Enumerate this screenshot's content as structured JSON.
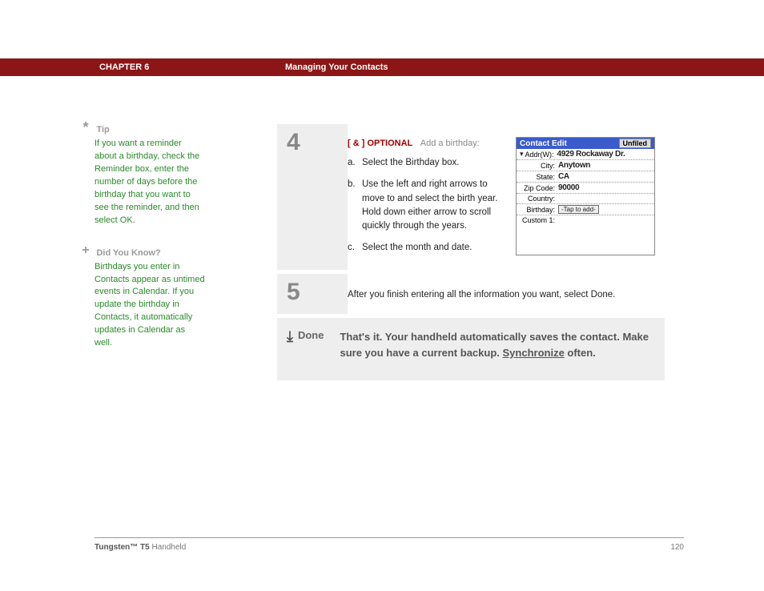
{
  "header": {
    "chapter": "CHAPTER 6",
    "title": "Managing Your Contacts"
  },
  "sidebar": {
    "tip": {
      "heading": "Tip",
      "body": "If you want a reminder about a birthday, check the Reminder box, enter the number of days before the birthday that you want to see the reminder, and then select OK."
    },
    "dyk": {
      "heading": "Did You Know?",
      "body": "Birthdays you enter in Contacts appear as untimed events in Calendar. If you update the birthday in Contacts, it automatically updates in Calendar as well."
    }
  },
  "steps": {
    "s4": {
      "num": "4",
      "tag": "[ & ]  OPTIONAL",
      "lead": "Add a birthday:",
      "a": "Select the Birthday box.",
      "b": "Use the left and right arrows to move to and select the birth year. Hold down either arrow to scroll quickly through the years.",
      "c": "Select the month and date."
    },
    "s5": {
      "num": "5",
      "text": "After you finish entering all the information you want, select Done."
    }
  },
  "device": {
    "title": "Contact Edit",
    "category": "Unfiled",
    "rows": {
      "addr_label": "Addr(W):",
      "addr_value": "4929 Rockaway Dr.",
      "city_label": "City:",
      "city_value": "Anytown",
      "state_label": "State:",
      "state_value": "CA",
      "zip_label": "Zip Code:",
      "zip_value": "90000",
      "country_label": "Country:",
      "country_value": "",
      "birthday_label": "Birthday:",
      "birthday_value": "-Tap to add-",
      "custom_label": "Custom 1:",
      "custom_value": ""
    }
  },
  "done": {
    "label": "Done",
    "text_before": "That's it. Your handheld automatically saves the contact. Make sure you have a current backup. ",
    "link": "Synchronize",
    "text_after": " often."
  },
  "footer": {
    "product_bold": "Tungsten™ T5",
    "product_rest": " Handheld",
    "page": "120"
  }
}
